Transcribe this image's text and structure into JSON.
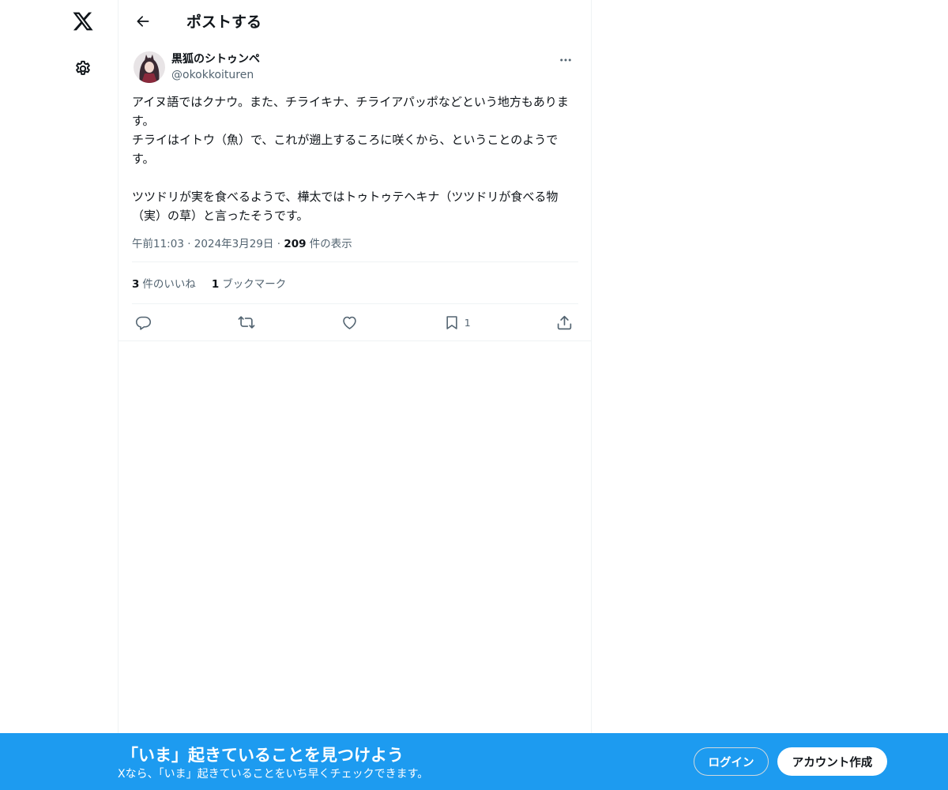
{
  "nav": {
    "logo_icon": "x-logo-icon",
    "settings_icon": "gear-icon"
  },
  "header": {
    "back_icon": "arrow-left-icon",
    "title": "ポストする"
  },
  "post": {
    "display_name": "黒狐のシトゥンペ",
    "handle": "@okokkoituren",
    "text": "アイヌ語ではクナウ。また、チライキナ、チライアパッポなどという地方もあります。\nチライはイトウ（魚）で、これが遡上するころに咲くから、ということのようです。\n\nツツドリが実を食べるようで、樺太ではトゥトゥテヘキナ（ツツドリが食べる物（実）の草）と言ったそうです。",
    "time": "午前11:03",
    "date": "2024年3月29日",
    "views_count": "209",
    "views_label": "件の表示",
    "separator": "·"
  },
  "stats": {
    "likes_count": "3",
    "likes_label": "件のいいね",
    "bookmarks_count": "1",
    "bookmarks_label": "ブックマーク"
  },
  "actions": {
    "reply_icon": "reply-icon",
    "repost_icon": "repost-icon",
    "like_icon": "heart-icon",
    "bookmark_icon": "bookmark-icon",
    "bookmark_count": "1",
    "share_icon": "share-icon"
  },
  "banner": {
    "title": "「いま」起きていることを見つけよう",
    "subtitle": "Xなら、「いま」起きていることをいち早くチェックできます。",
    "login_label": "ログイン",
    "signup_label": "アカウント作成",
    "background_color": "#1d9bf0"
  }
}
